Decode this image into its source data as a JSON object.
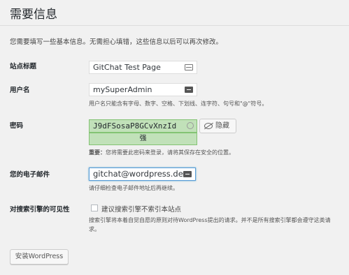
{
  "heading": "需要信息",
  "intro": "您需要填写一些基本信息。无需担心填错，这些信息以后可以再次修改。",
  "site_title": {
    "label": "站点标题",
    "value": "GitChat Test Page"
  },
  "username": {
    "label": "用户名",
    "value": "mySuperAdmin",
    "hint": "用户名只能含有字母、数字、空格、下划线、连字符、句号和\"@\"符号。"
  },
  "password": {
    "label": "密码",
    "value": "J9dFSosaP8GCvXnzId",
    "strength": "强",
    "hide_label": "隐藏",
    "important_prefix": "重要：",
    "important_text": "您将需要此密码来登录，请将其保存在安全的位置。"
  },
  "email": {
    "label": "您的电子邮件",
    "value": "gitchat@wordpress.dev",
    "hint": "请仔细检查电子邮件地址后再继续。"
  },
  "visibility": {
    "label": "对搜索引擎的可见性",
    "checkbox_label": "建议搜索引擎不索引本站点",
    "checked": false,
    "hint_line1": "搜索引擎将本着自觉自愿的原则对待WordPress提出的请求。并不是所有搜索引擎都会遵守这类请",
    "hint_line2": "求。"
  },
  "install_button": "安装WordPress"
}
